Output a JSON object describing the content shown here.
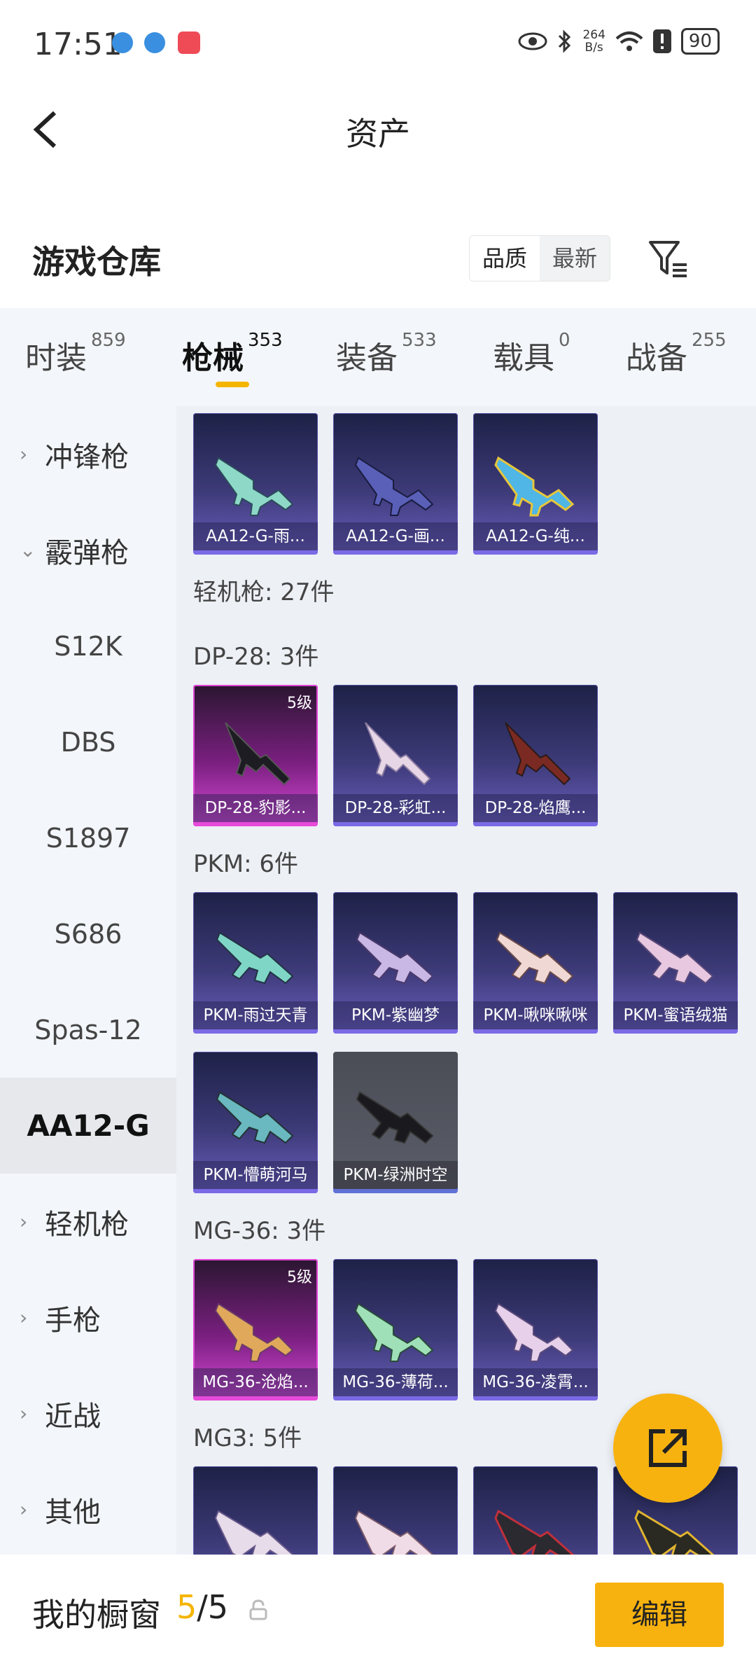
{
  "status_bar": {
    "time": "17:51",
    "net_speed_value": "264",
    "net_speed_unit": "B/s",
    "battery": "90"
  },
  "header": {
    "title": "资产"
  },
  "section": {
    "title": "游戏仓库",
    "sort_options": [
      "品质",
      "最新"
    ],
    "selected_sort": "品质"
  },
  "tabs": [
    {
      "label": "时装",
      "count": "859"
    },
    {
      "label": "枪械",
      "count": "353"
    },
    {
      "label": "装备",
      "count": "533"
    },
    {
      "label": "载具",
      "count": "0"
    },
    {
      "label": "战备",
      "count": "255"
    }
  ],
  "active_tab": "枪械",
  "sidebar": {
    "items": [
      {
        "label": "冲锋枪",
        "type": "category",
        "expanded": false
      },
      {
        "label": "霰弹枪",
        "type": "category",
        "expanded": true
      },
      {
        "label": "S12K",
        "type": "sub"
      },
      {
        "label": "DBS",
        "type": "sub"
      },
      {
        "label": "S1897",
        "type": "sub"
      },
      {
        "label": "S686",
        "type": "sub"
      },
      {
        "label": "Spas-12",
        "type": "sub"
      },
      {
        "label": "AA12-G",
        "type": "sub",
        "selected": true
      },
      {
        "label": "轻机枪",
        "type": "category",
        "expanded": false
      },
      {
        "label": "手枪",
        "type": "category",
        "expanded": false
      },
      {
        "label": "近战",
        "type": "category",
        "expanded": false
      },
      {
        "label": "其他",
        "type": "category",
        "expanded": false
      }
    ]
  },
  "content": {
    "aa12_items": [
      "AA12-G-雨...",
      "AA12-G-画...",
      "AA12-G-纯..."
    ],
    "category_label": "轻机枪: 27件",
    "groups": [
      {
        "label": "DP-28: 3件",
        "items": [
          {
            "name": "DP-28-豹影...",
            "level": "5级",
            "rarity": "gold"
          },
          {
            "name": "DP-28-彩虹...",
            "rarity": "purple"
          },
          {
            "name": "DP-28-焰鹰...",
            "rarity": "purple"
          }
        ]
      },
      {
        "label": "PKM: 6件",
        "items": [
          {
            "name": "PKM-雨过天青",
            "rarity": "purple"
          },
          {
            "name": "PKM-紫幽梦",
            "rarity": "purple"
          },
          {
            "name": "PKM-啾咪啾咪",
            "rarity": "purple"
          },
          {
            "name": "PKM-蜜语绒猫",
            "rarity": "purple"
          },
          {
            "name": "PKM-懵萌河马",
            "rarity": "purple"
          },
          {
            "name": "PKM-绿洲时空",
            "rarity": "gray"
          }
        ]
      },
      {
        "label": "MG-36: 3件",
        "items": [
          {
            "name": "MG-36-沧焰...",
            "level": "5级",
            "rarity": "gold"
          },
          {
            "name": "MG-36-薄荷...",
            "rarity": "purple"
          },
          {
            "name": "MG-36-凌霄...",
            "rarity": "purple"
          }
        ]
      },
      {
        "label": "MG3: 5件"
      }
    ]
  },
  "bottom_bar": {
    "label": "我的橱窗",
    "current": "5",
    "separator": "/",
    "total": "5",
    "edit_button": "编辑"
  },
  "colors": {
    "accent": "#f7b20f",
    "purple_card": "#3d3a78",
    "gold_card": "#d94ad8"
  }
}
